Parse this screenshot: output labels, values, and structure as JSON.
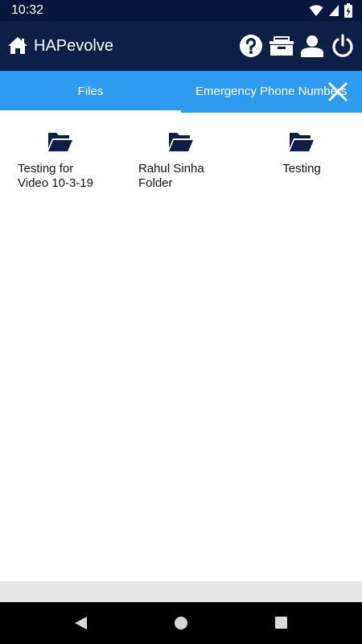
{
  "status_bar": {
    "time": "10:32",
    "icons": [
      "wifi-icon",
      "signal-icon",
      "battery-charging-icon"
    ]
  },
  "app_bar": {
    "title": "HAPevolve",
    "home_icon": "home-icon",
    "actions": [
      "help-icon",
      "inbox-icon",
      "profile-icon",
      "power-icon"
    ]
  },
  "tabs": [
    {
      "label": "Files",
      "selected": true
    },
    {
      "label": "Emergency Phone Numbers",
      "selected": false
    }
  ],
  "close_icon": "close-icon",
  "folders": [
    {
      "label": "Testing for\nVideo 10-3-19",
      "icon": "folder-open-icon"
    },
    {
      "label": "Rahul Sinha\nFolder",
      "icon": "folder-open-icon"
    },
    {
      "label": "Testing",
      "icon": "folder-open-icon"
    }
  ],
  "colors": {
    "status_bar": "#06173d",
    "app_bar": "#0b1f47",
    "tab_bar": "#2d9bf0",
    "folder_icon": "#0b1f47"
  },
  "nav_bar": [
    "back-icon",
    "home-circle-icon",
    "recents-icon"
  ]
}
